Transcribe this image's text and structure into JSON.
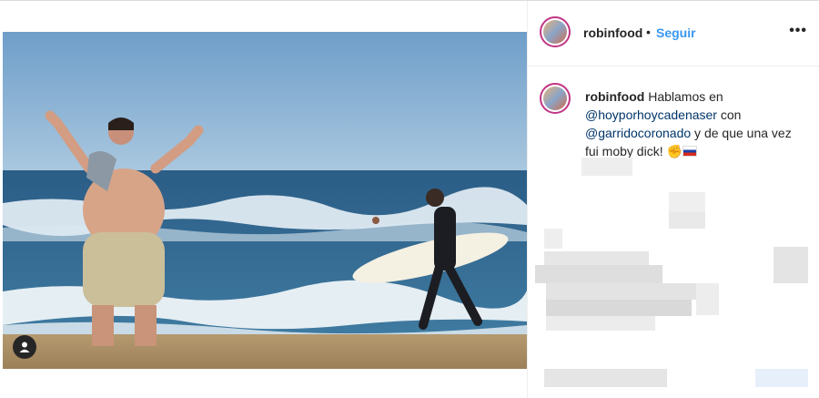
{
  "post": {
    "username": "robinfood",
    "follow_label": "Seguir",
    "separator": "•",
    "more_label": "•••"
  },
  "caption": {
    "username": "robinfood",
    "text_1": " Hablamos en ",
    "mention_1": "@hoyporhoycadenaser",
    "text_2": " con ",
    "mention_2": "@garridocoronado",
    "text_3": " y de que una vez fui moby dick! ",
    "emoji": "✊"
  },
  "icons": {
    "tagged_people": "user-tag-icon",
    "more": "ellipsis-icon"
  },
  "colors": {
    "link_blue": "#3897f0",
    "mention_blue": "#003569",
    "story_ring": "#c13584"
  }
}
